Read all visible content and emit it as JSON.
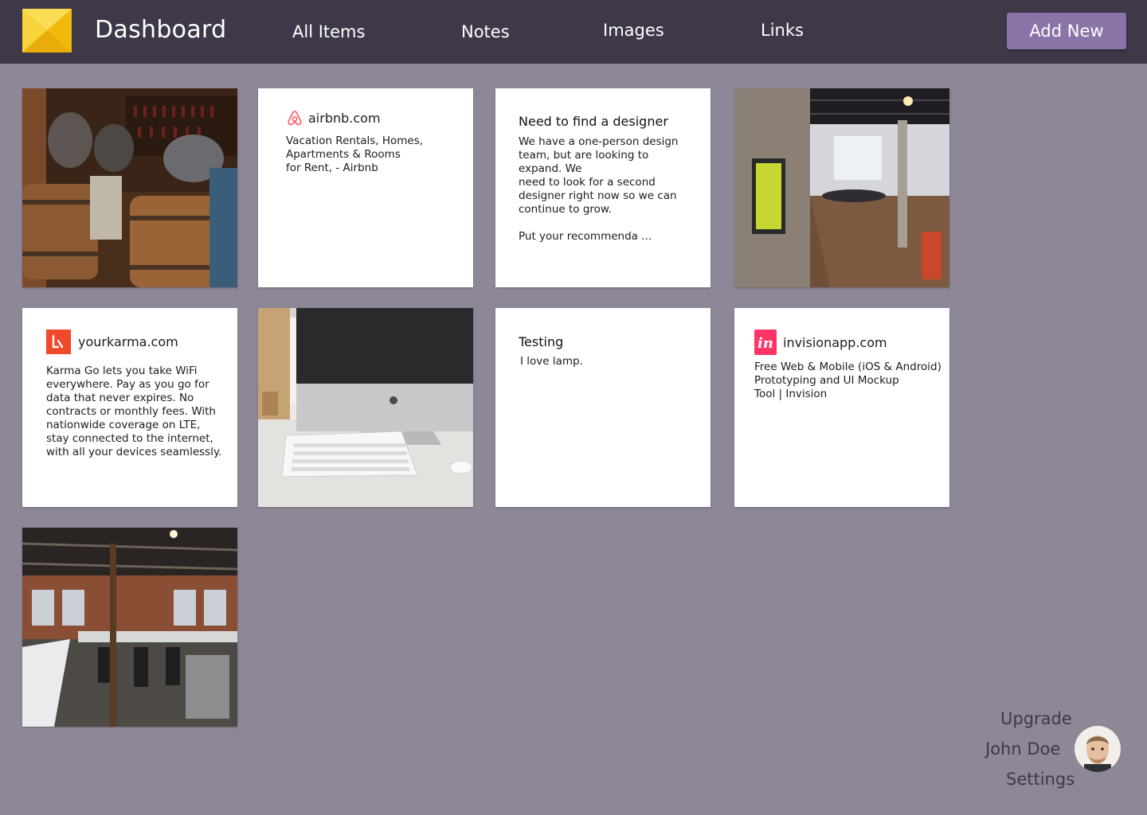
{
  "header": {
    "title": "Dashboard",
    "nav": [
      "All Items",
      "Notes",
      "Images",
      "Links"
    ],
    "add_button": "Add New"
  },
  "cards": {
    "airbnb": {
      "domain": "airbnb.com",
      "description": "Vacation Rentals, Homes,\nApartments & Rooms\nfor Rent,  - Airbnb"
    },
    "designer_note": {
      "title": "Need to find a designer",
      "body": "We have a one-person design\nteam, but are looking to\nexpand. We\nneed to look for a second\ndesigner right now so we can\ncontinue to grow.\n\nPut your recommenda ..."
    },
    "yourkarma": {
      "domain": "yourkarma.com",
      "description": "Karma Go lets you take WiFi\neverywhere. Pay as you go for\ndata that never expires. No\ncontracts or monthly fees. With\nnationwide coverage on LTE,\nstay connected to the internet,\nwith all your devices seamlessly."
    },
    "testing_note": {
      "title": "Testing",
      "body": "I love lamp."
    },
    "invision": {
      "domain": "invisionapp.com",
      "description": "Free Web & Mobile (iOS & Android)\nPrototyping and UI Mockup\nTool | Invision"
    }
  },
  "user_menu": {
    "upgrade": "Upgrade",
    "name": "John Doe",
    "settings": "Settings"
  },
  "icons": {
    "logo": "envelope-logo-icon",
    "airbnb": "airbnb-icon",
    "karma": "karma-icon",
    "invision": "invision-icon"
  },
  "colors": {
    "topbar": "#3f3849",
    "background": "#8d8797",
    "accent": "#8a74a8",
    "logo": "#f5c518",
    "airbnb": "#ff5a5f",
    "karma": "#ef4a2b",
    "invision": "#ff3366"
  }
}
